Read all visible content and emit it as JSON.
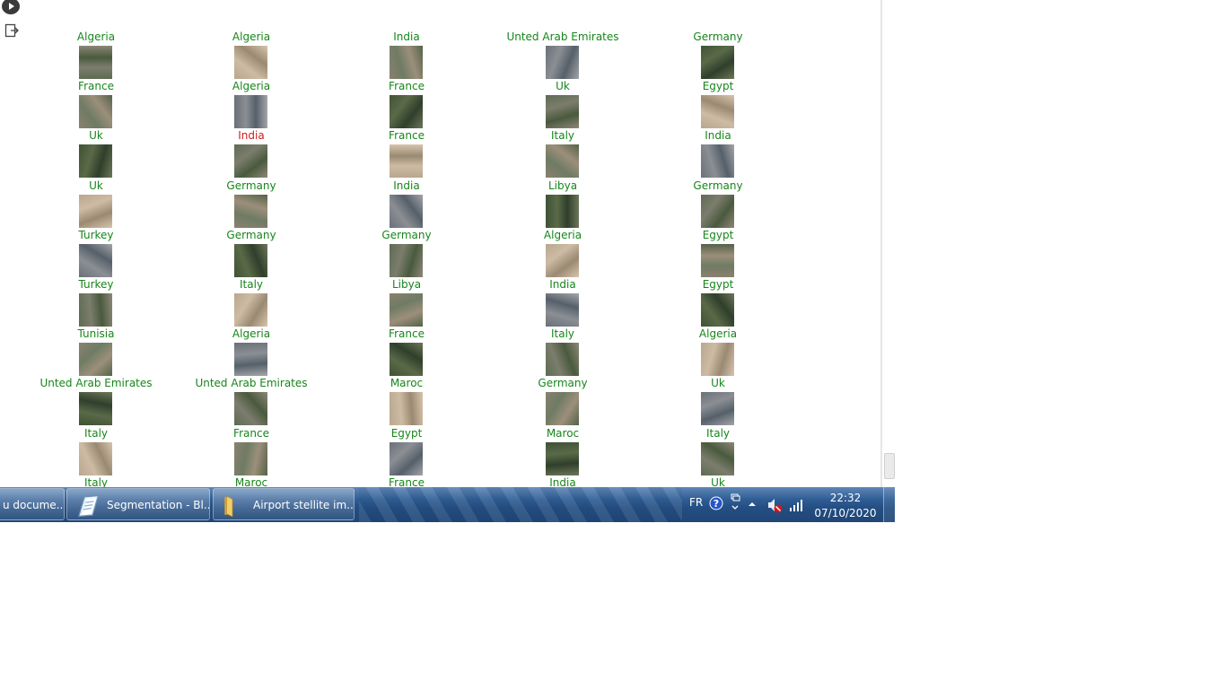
{
  "notebook": {
    "run_button_icon": "play-icon",
    "output_toggle_icon": "output-toggle-icon"
  },
  "grid": {
    "colors": {
      "correct": "#16861a",
      "wrong": "#d11a1a"
    },
    "columns": [
      {
        "items": [
          {
            "label": "Algeria",
            "correct": true
          },
          {
            "label": "France",
            "correct": true
          },
          {
            "label": "Uk",
            "correct": true
          },
          {
            "label": "Uk",
            "correct": true
          },
          {
            "label": "Turkey",
            "correct": true
          },
          {
            "label": "Turkey",
            "correct": true
          },
          {
            "label": "Tunisia",
            "correct": true
          },
          {
            "label": "Unted Arab Emirates",
            "correct": true
          },
          {
            "label": "Italy",
            "correct": true
          },
          {
            "label": "Italy",
            "correct": true
          }
        ]
      },
      {
        "items": [
          {
            "label": "Algeria",
            "correct": true
          },
          {
            "label": "Algeria",
            "correct": true
          },
          {
            "label": "India",
            "correct": false
          },
          {
            "label": "Germany",
            "correct": true
          },
          {
            "label": "Germany",
            "correct": true
          },
          {
            "label": "Italy",
            "correct": true
          },
          {
            "label": "Algeria",
            "correct": true
          },
          {
            "label": "Unted Arab Emirates",
            "correct": true
          },
          {
            "label": "France",
            "correct": true
          },
          {
            "label": "Maroc",
            "correct": true
          }
        ]
      },
      {
        "items": [
          {
            "label": "India",
            "correct": true
          },
          {
            "label": "France",
            "correct": true
          },
          {
            "label": "France",
            "correct": true
          },
          {
            "label": "India",
            "correct": true
          },
          {
            "label": "Germany",
            "correct": true
          },
          {
            "label": "Libya",
            "correct": true
          },
          {
            "label": "France",
            "correct": true
          },
          {
            "label": "Maroc",
            "correct": true
          },
          {
            "label": "Egypt",
            "correct": true
          },
          {
            "label": "France",
            "correct": true
          }
        ]
      },
      {
        "items": [
          {
            "label": "Unted Arab Emirates",
            "correct": true
          },
          {
            "label": "Uk",
            "correct": true
          },
          {
            "label": "Italy",
            "correct": true
          },
          {
            "label": "Libya",
            "correct": true
          },
          {
            "label": "Algeria",
            "correct": true
          },
          {
            "label": "India",
            "correct": true
          },
          {
            "label": "Italy",
            "correct": true
          },
          {
            "label": "Germany",
            "correct": true
          },
          {
            "label": "Maroc",
            "correct": true
          },
          {
            "label": "India",
            "correct": true
          }
        ]
      },
      {
        "items": [
          {
            "label": "Germany",
            "correct": true
          },
          {
            "label": "Egypt",
            "correct": true
          },
          {
            "label": "India",
            "correct": true
          },
          {
            "label": "Germany",
            "correct": true
          },
          {
            "label": "Egypt",
            "correct": true
          },
          {
            "label": "Egypt",
            "correct": true
          },
          {
            "label": "Algeria",
            "correct": true
          },
          {
            "label": "Uk",
            "correct": true
          },
          {
            "label": "Italy",
            "correct": true
          },
          {
            "label": "Uk",
            "correct": true
          }
        ]
      }
    ]
  },
  "taskbar": {
    "buttons": [
      {
        "label": "u docume...",
        "icon": "document-icon"
      },
      {
        "label": "Segmentation - Bl...",
        "icon": "notepad-icon"
      },
      {
        "label": "Airport stellite im...",
        "icon": "folder-icon"
      }
    ],
    "tray": {
      "language": "FR",
      "time": "22:32",
      "date": "07/10/2020"
    }
  }
}
